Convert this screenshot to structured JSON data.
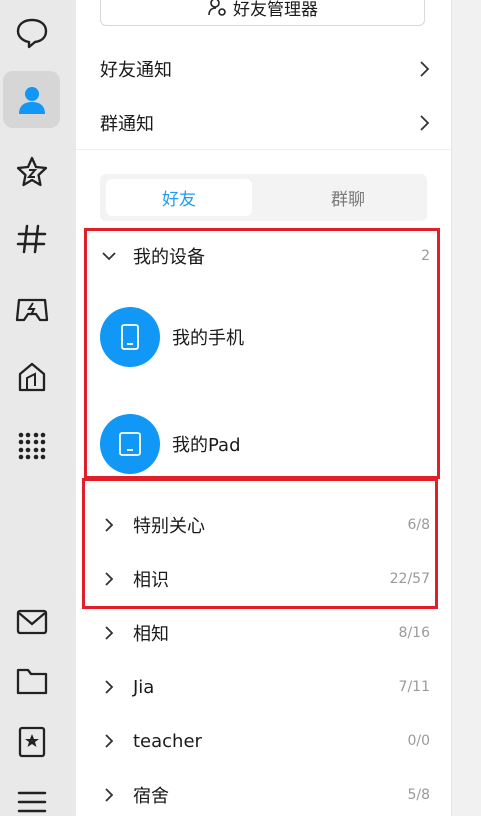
{
  "sidebar": {
    "icons": [
      "message-icon",
      "contacts-icon",
      "star-icon",
      "channel-icon",
      "game-icon",
      "shop-icon",
      "apps-grid-icon",
      "mail-icon",
      "folder-icon",
      "bookmark-icon",
      "menu-icon"
    ]
  },
  "top": {
    "manager_button": "好友管理器"
  },
  "notices": {
    "friend": "好友通知",
    "group": "群通知"
  },
  "tabs": {
    "friends": "好友",
    "groups": "群聊"
  },
  "devices": {
    "title": "我的设备",
    "count": "2",
    "items": [
      {
        "name": "我的手机"
      },
      {
        "name": "我的Pad"
      }
    ]
  },
  "groups": [
    {
      "name": "特别关心",
      "count": "6/8"
    },
    {
      "name": "相识",
      "count": "22/57"
    },
    {
      "name": "相知",
      "count": "8/16"
    },
    {
      "name": "Jia",
      "count": "7/11"
    },
    {
      "name": "teacher",
      "count": "0/0"
    },
    {
      "name": "宿舍",
      "count": "5/8"
    }
  ],
  "colors": {
    "accent": "#1e9bf0",
    "avatar": "#1197f5",
    "highlight": "#e01f2a"
  }
}
